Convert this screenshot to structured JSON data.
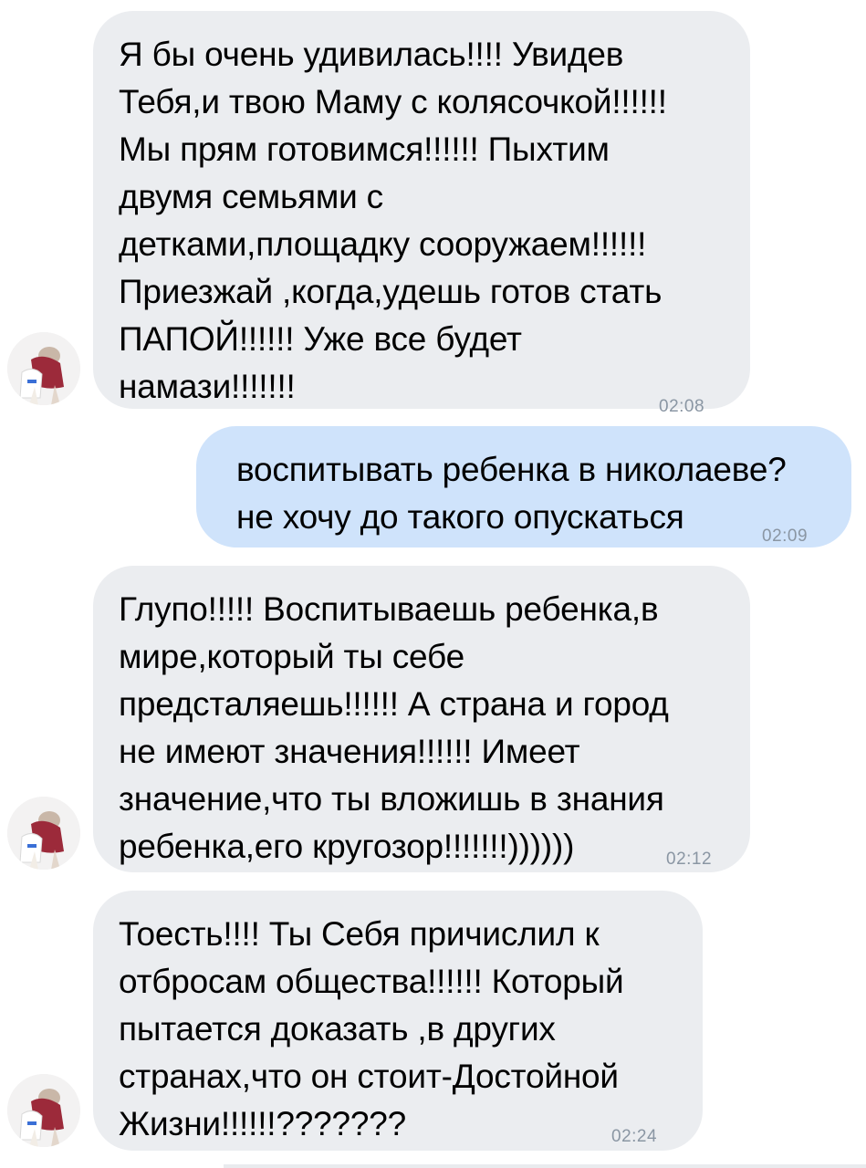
{
  "messages": [
    {
      "direction": "incoming",
      "text": "Я бы очень удивилась!!!! Увидев\nТебя,и твою Маму с колясочкой!!!!!!\nМы прям готовимся!!!!!! Пыхтим\nдвумя семьями с\nдетками,площадку сооружаем!!!!!!\nПриезжай ,когда,удешь готов стать\nПАПОЙ!!!!!! Уже все будет\nнамази!!!!!!!",
      "time": "02:08"
    },
    {
      "direction": "outgoing",
      "text": "воспитывать ребенка в николаеве?\nне хочу до такого опускаться",
      "time": "02:09"
    },
    {
      "direction": "incoming",
      "text": "Глупо!!!!! Воспитываешь ребенка,в\nмире,который ты себе\nпредсталяешь!!!!!! А страна и город\nне имеют значения!!!!!! Имеет\nзначение,что ты вложишь в знания\nребенка,его кругозор!!!!!!!))))))",
      "time": "02:12"
    },
    {
      "direction": "incoming",
      "text": "Тоесть!!!! Ты Себя причислил к\nотбросам общества!!!!!! Который\nпытается доказать ,в других\nстранах,что он стоит-Достойной\nЖизни!!!!!!???????",
      "time": "02:24"
    }
  ],
  "colors": {
    "incoming_bubble": "#ebedf0",
    "outgoing_bubble": "#cfe3fb",
    "timestamp": "#8a96a3"
  },
  "icons": {
    "avatar": "contact-avatar-photo"
  }
}
